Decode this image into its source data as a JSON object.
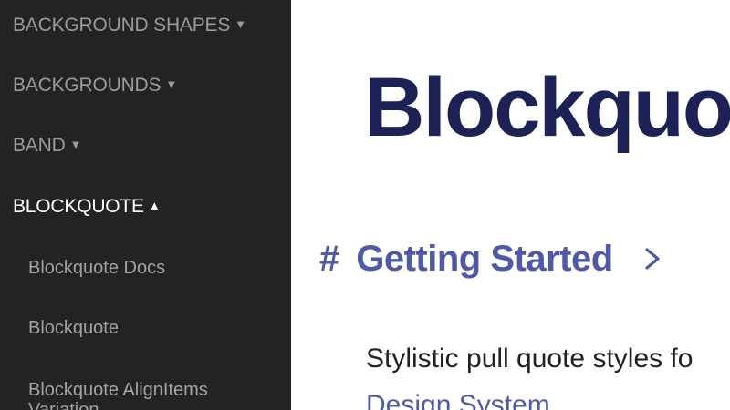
{
  "sidebar": {
    "groups": [
      {
        "label": "BACKGROUND SHAPES",
        "caret": "▼"
      },
      {
        "label": "BACKGROUNDS",
        "caret": "▼"
      },
      {
        "label": "BAND",
        "caret": "▼"
      },
      {
        "label": "BLOCKQUOTE",
        "caret": "▲"
      }
    ],
    "sub_items": [
      {
        "label": "Blockquote Docs"
      },
      {
        "label": "Blockquote"
      },
      {
        "label": "Blockquote AlignItems Variation"
      }
    ]
  },
  "main": {
    "title": "Blockquote",
    "section": {
      "anchor": "#",
      "heading": "Getting Started",
      "chevron_icon": "chevron-right-icon"
    },
    "description": "Stylistic pull quote styles fo",
    "link": "Design System"
  },
  "colors": {
    "sidebar_bg": "#232323",
    "sidebar_text": "#9b9b9b",
    "sidebar_active": "#ffffff",
    "title": "#1d2256",
    "accent": "#4f5aa6"
  }
}
